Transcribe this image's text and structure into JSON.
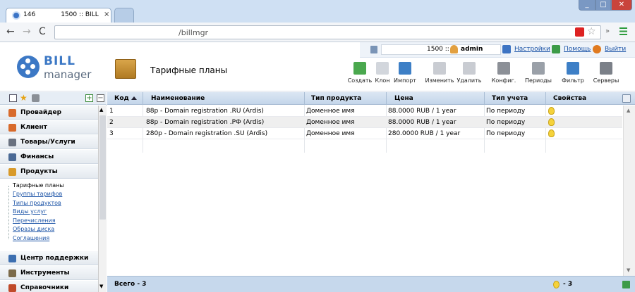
{
  "browser": {
    "tab_title": "146",
    "tab_subtitle": "1500 :: BILL",
    "tab_close": "×",
    "url": "/billmgr",
    "min": "_",
    "max": "□",
    "close": "✕"
  },
  "app": {
    "logo_line1": "BILL",
    "logo_line2": "manager",
    "page_title": "Тарифные планы",
    "user_id": "1500 ::",
    "username": "admin",
    "settings_label": "Настройки",
    "help_label": "Помощь",
    "logout_label": "Выйти"
  },
  "toolbar": [
    {
      "label": "Создать",
      "color": "#4aa84e"
    },
    {
      "label": "Клон",
      "color": "#d2d6dc"
    },
    {
      "label": "Импорт",
      "color": "#3d7fc6"
    },
    {
      "label": "Изменить",
      "color": "#c9ccd2"
    },
    {
      "label": "Удалить",
      "color": "#c9ccd2"
    },
    {
      "label": "Конфиг.",
      "color": "#8c9097"
    },
    {
      "label": "Периоды",
      "color": "#9aa0a8"
    },
    {
      "label": "Фильтр",
      "color": "#3d7fc6"
    },
    {
      "label": "Серверы",
      "color": "#7b8088"
    }
  ],
  "sidebar": {
    "plus": "+",
    "minus": "−",
    "star": "★",
    "menus": [
      {
        "label": "Провайдер",
        "color": "#d86a2b"
      },
      {
        "label": "Клиент",
        "color": "#d86a2b"
      },
      {
        "label": "Товары/Услуги",
        "color": "#6a7280"
      },
      {
        "label": "Финансы",
        "color": "#4b6a95"
      },
      {
        "label": "Продукты",
        "color": "#d89a2a"
      }
    ],
    "subitems": [
      "Тарифные планы",
      "Группы тарифов",
      "Типы продуктов",
      "Виды услуг",
      "Перечисления",
      "Образы диска",
      "Соглашения"
    ],
    "bottom_menus": [
      {
        "label": "Центр поддержки",
        "color": "#3d6fb0"
      },
      {
        "label": "Инструменты",
        "color": "#7b6a4a"
      },
      {
        "label": "Справочники",
        "color": "#c04a2a"
      }
    ]
  },
  "grid": {
    "columns": [
      "Код",
      "Наименование",
      "Тип продукта",
      "Цена",
      "Тип учета",
      "Свойства"
    ],
    "rows": [
      {
        "id": "1",
        "name": "88p - Domain registration .RU (Ardis)",
        "type": "Доменное имя",
        "price": "88.0000 RUB / 1 year",
        "billing": "По периоду"
      },
      {
        "id": "2",
        "name": "88p - Domain registration .РФ (Ardis)",
        "type": "Доменное имя",
        "price": "88.0000 RUB / 1 year",
        "billing": "По периоду"
      },
      {
        "id": "3",
        "name": "280p - Domain registration .SU (Ardis)",
        "type": "Доменное имя",
        "price": "280.0000 RUB / 1 year",
        "billing": "По периоду"
      }
    ],
    "total": "Всего - 3",
    "bulb_count": "- 3"
  }
}
